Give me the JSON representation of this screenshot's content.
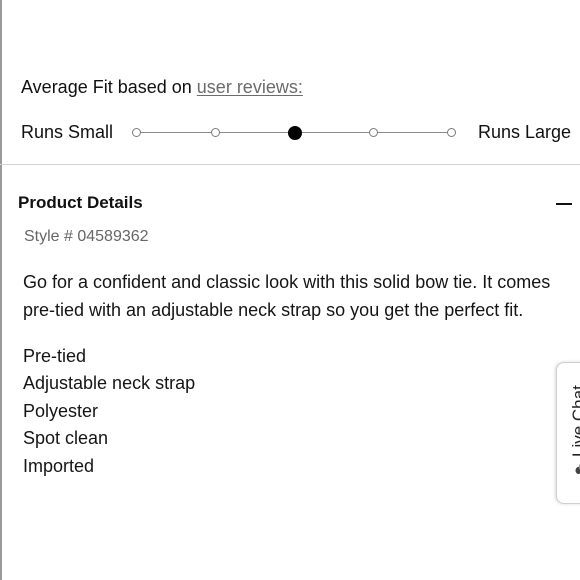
{
  "fit": {
    "title_prefix": "Average Fit based on",
    "title_link": "user reviews:",
    "label_small": "Runs Small",
    "label_large": "Runs Large",
    "scale_points": 5,
    "selected_index": 2
  },
  "details": {
    "header": "Product Details",
    "style_number": "Style # 04589362",
    "description": "Go for a confident and classic look with this solid bow tie. It comes pre-tied with an adjustable neck strap so you get the perfect fit.",
    "features": [
      "Pre-tied",
      "Adjustable neck strap",
      "Polyester",
      "Spot clean",
      "Imported"
    ]
  },
  "live_chat": {
    "label": "Live Chat",
    "icon": "chat-bubbles-icon"
  }
}
